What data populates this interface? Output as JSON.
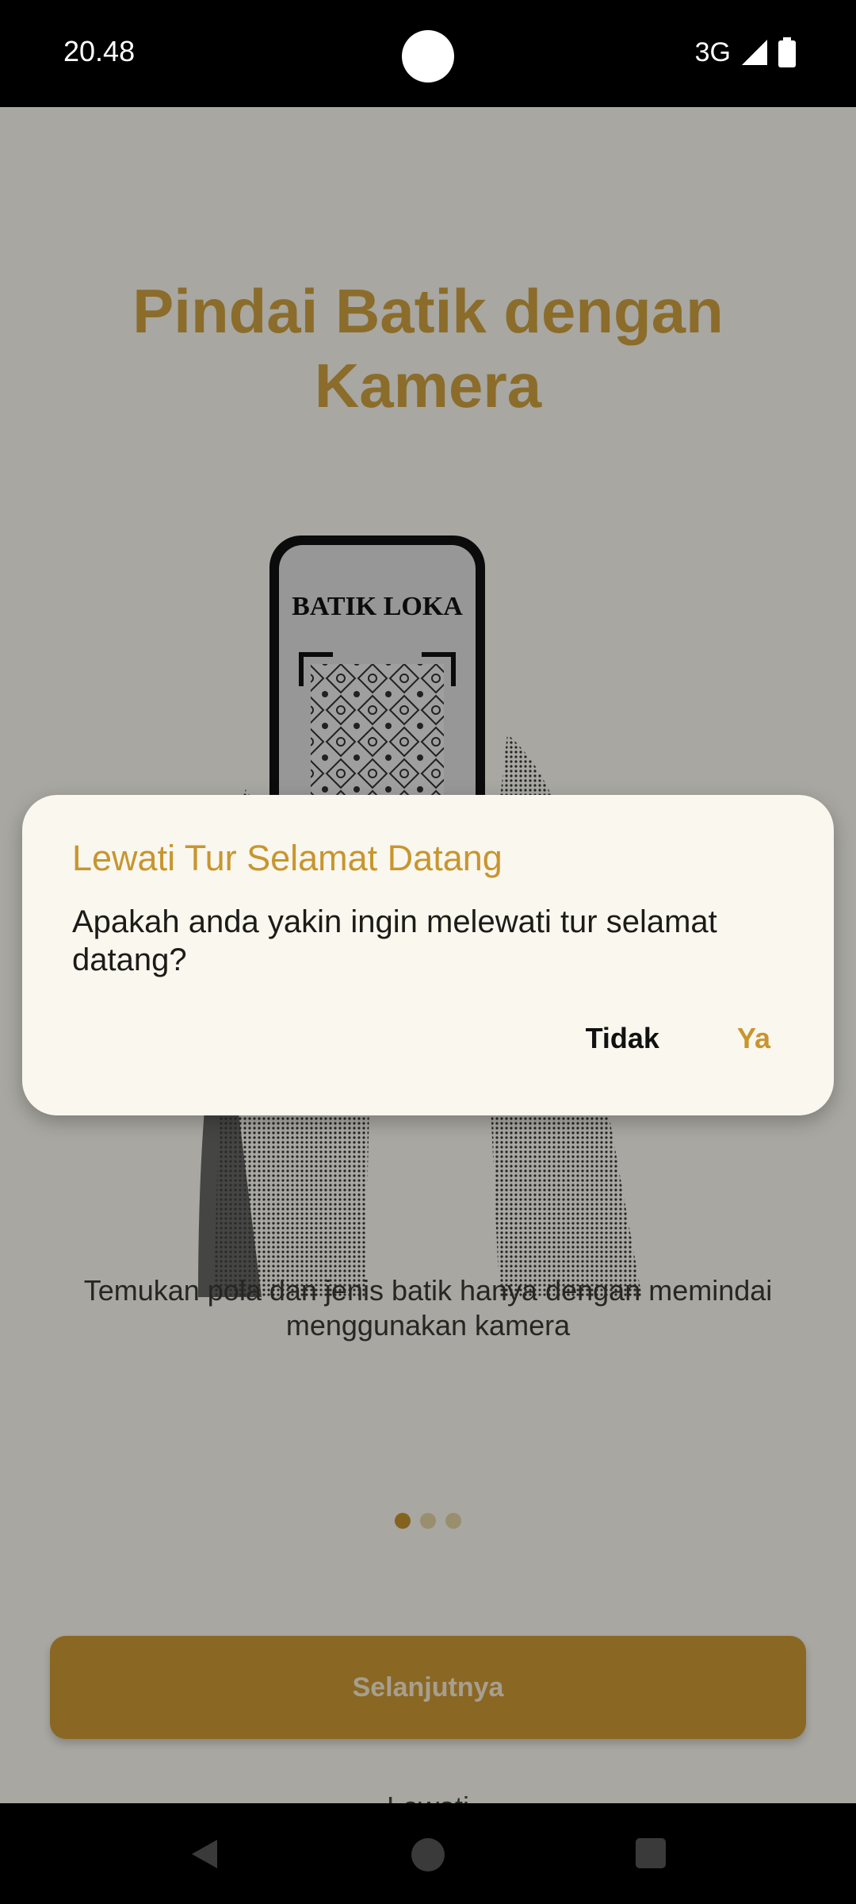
{
  "status_bar": {
    "time": "20.48",
    "network": "3G",
    "icons": [
      "signal-icon",
      "battery-icon"
    ]
  },
  "onboarding": {
    "title": "Pindai Batik dengan Kamera",
    "phone_brand": "BATIK LOKA",
    "description": "Temukan pola dan jenis batik hanya dengan memindai menggunakan kamera",
    "page_indicator": {
      "total": 3,
      "active": 1
    },
    "next_label": "Selanjutnya",
    "skip_label": "Lewati"
  },
  "dialog": {
    "title": "Lewati Tur Selamat Datang",
    "message": "Apakah anda yakin ingin melewati tur selamat datang?",
    "cancel_label": "Tidak",
    "confirm_label": "Ya"
  },
  "nav_bar": {
    "buttons": [
      "back-icon",
      "home-icon",
      "recents-icon"
    ]
  },
  "colors": {
    "accent": "#d3a440",
    "dialog_bg": "#f9f7ee",
    "scrim": "rgba(0,0,0,0.34)"
  }
}
